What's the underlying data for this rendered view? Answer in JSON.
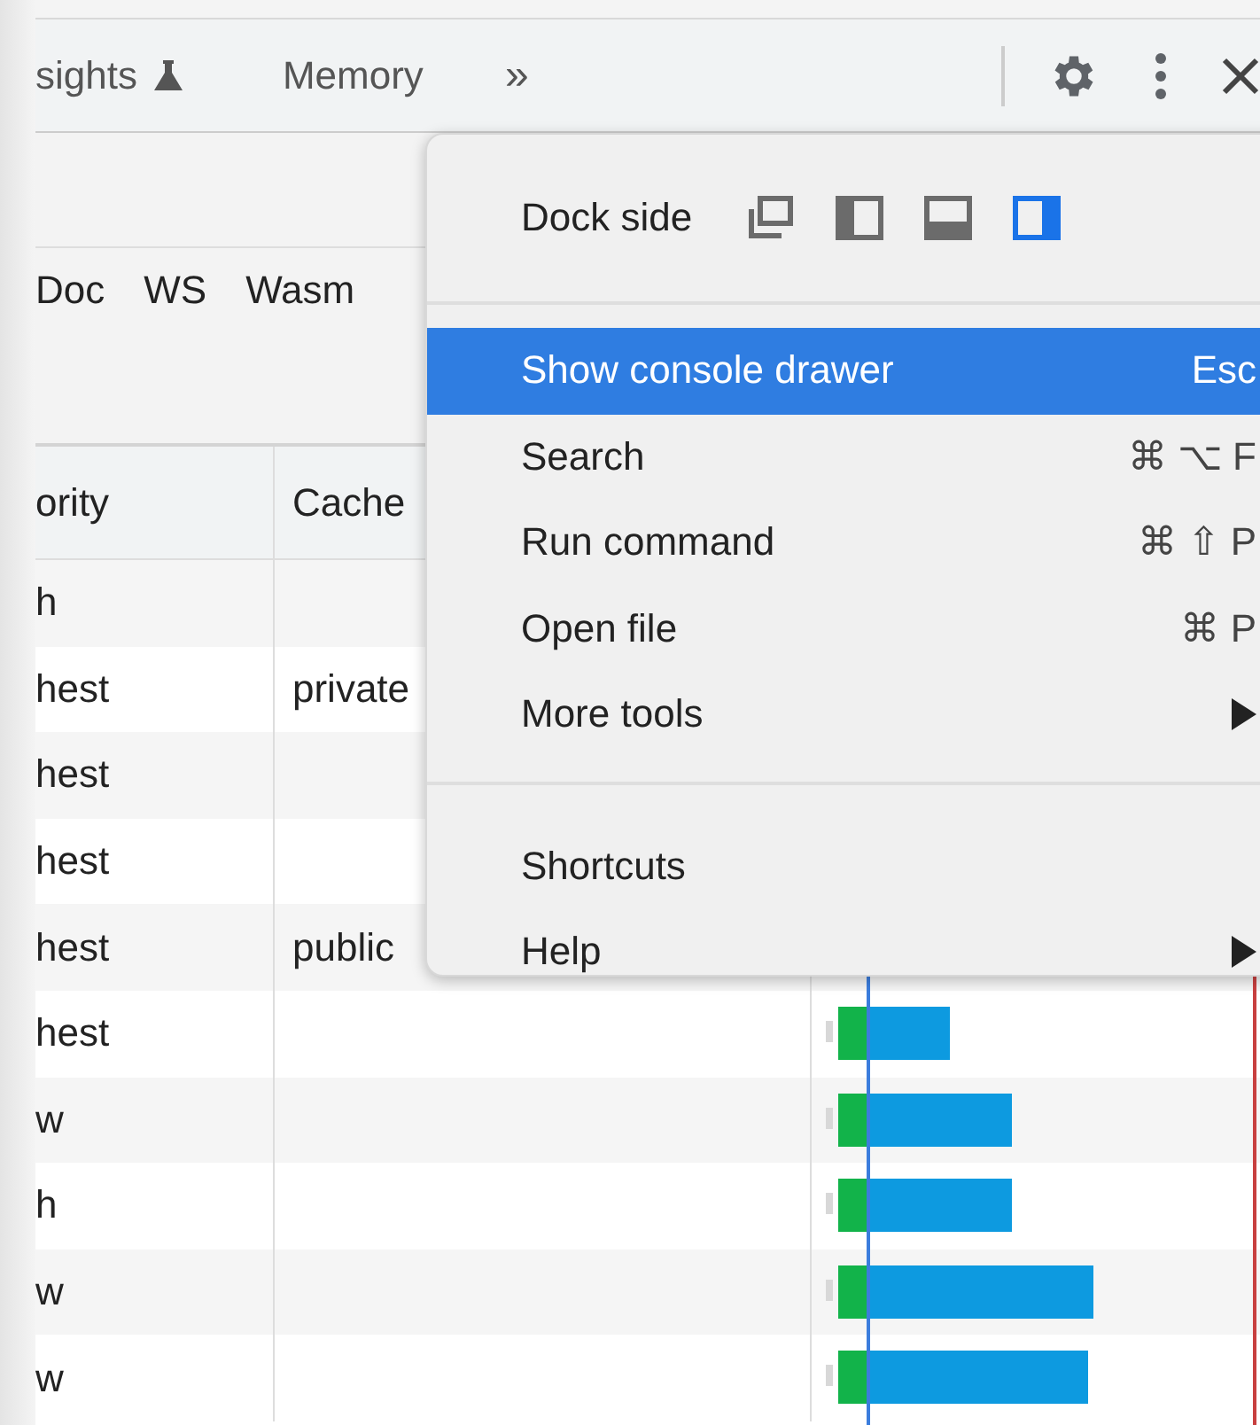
{
  "tabs": [
    {
      "label": "sights",
      "kind": "experimental",
      "selected": false
    },
    {
      "label": "Memory",
      "kind": "plain",
      "selected": false
    },
    {
      "label": "»",
      "kind": "more",
      "selected": false
    }
  ],
  "filters": [
    "Doc",
    "WS",
    "Wasm"
  ],
  "table": {
    "columns": [
      "ority",
      "Cache"
    ],
    "rows": [
      {
        "priority": "h",
        "cache": ""
      },
      {
        "priority": "hest",
        "cache": "private"
      },
      {
        "priority": "hest",
        "cache": ""
      },
      {
        "priority": "hest",
        "cache": ""
      },
      {
        "priority": "hest",
        "cache": "public"
      },
      {
        "priority": "hest",
        "cache": ""
      },
      {
        "priority": "w",
        "cache": ""
      },
      {
        "priority": "h",
        "cache": ""
      },
      {
        "priority": "w",
        "cache": ""
      },
      {
        "priority": "w",
        "cache": ""
      }
    ]
  },
  "menu": {
    "dock_label": "Dock side",
    "dock_options": [
      {
        "kind": "undock",
        "selected": false
      },
      {
        "kind": "left",
        "selected": false
      },
      {
        "kind": "bottom",
        "selected": false
      },
      {
        "kind": "right",
        "selected": true
      }
    ],
    "groups": [
      [
        {
          "label": "Show console drawer",
          "shortcut": "Esc",
          "submenu": false,
          "selected": true
        },
        {
          "label": "Search",
          "shortcut": "⌘ ⌥ F",
          "submenu": false,
          "selected": false
        },
        {
          "label": "Run command",
          "shortcut": "⌘ ⇧ P",
          "submenu": false,
          "selected": false
        },
        {
          "label": "Open file",
          "shortcut": "⌘ P",
          "submenu": false,
          "selected": false
        },
        {
          "label": "More tools",
          "submenu": true,
          "selected": false
        }
      ],
      [
        {
          "label": "Shortcuts",
          "submenu": false,
          "selected": false
        },
        {
          "label": "Help",
          "submenu": true,
          "selected": false
        }
      ]
    ]
  }
}
